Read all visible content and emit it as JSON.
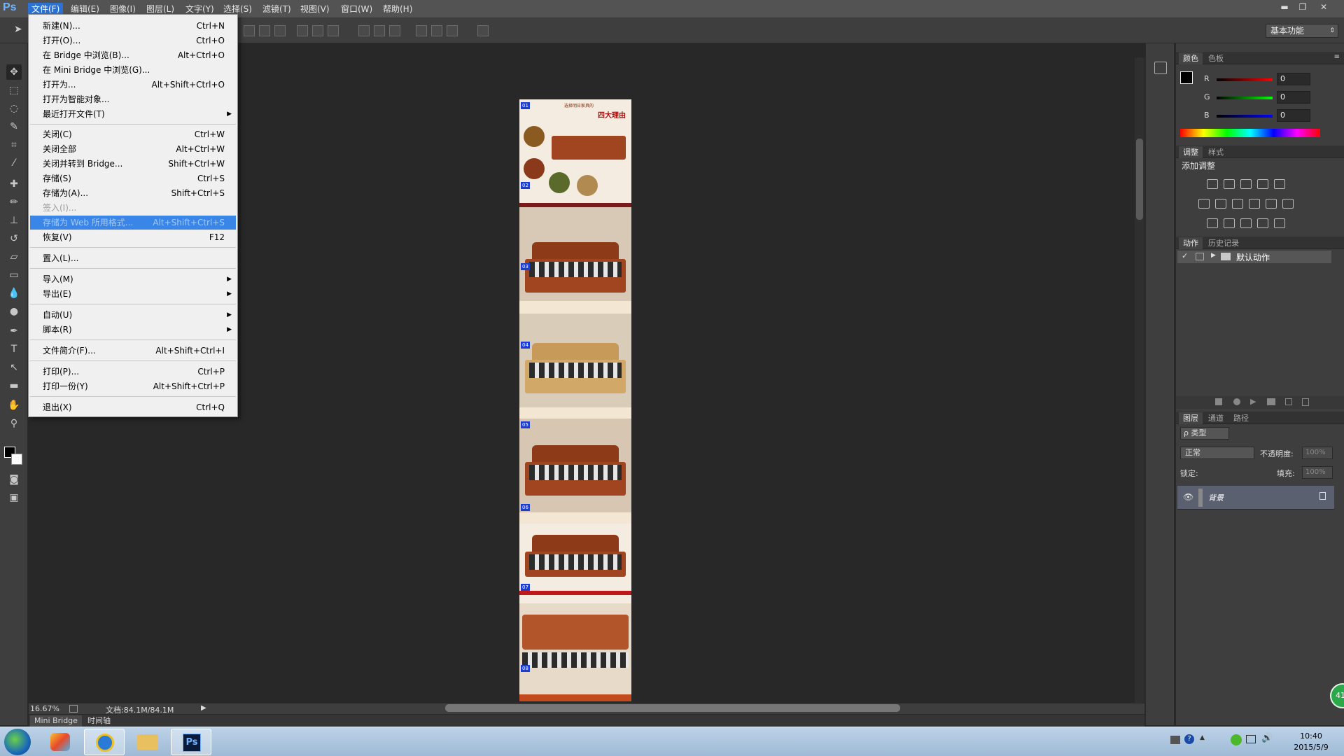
{
  "app": {
    "logo": "Ps"
  },
  "menubar": {
    "items": [
      "文件(F)",
      "编辑(E)",
      "图像(I)",
      "图层(L)",
      "文字(Y)",
      "选择(S)",
      "滤镜(T)",
      "视图(V)",
      "窗口(W)",
      "帮助(H)"
    ],
    "active": "文件(F)"
  },
  "window_controls": {
    "minimize": "▬",
    "restore": "❐",
    "close": "✕"
  },
  "workspace": {
    "label": "基本功能"
  },
  "file_menu": {
    "items": [
      {
        "label": "新建(N)...",
        "shortcut": "Ctrl+N"
      },
      {
        "label": "打开(O)...",
        "shortcut": "Ctrl+O"
      },
      {
        "label": "在 Bridge 中浏览(B)...",
        "shortcut": "Alt+Ctrl+O"
      },
      {
        "label": "在 Mini Bridge 中浏览(G)...",
        "shortcut": ""
      },
      {
        "label": "打开为...",
        "shortcut": "Alt+Shift+Ctrl+O"
      },
      {
        "label": "打开为智能对象...",
        "shortcut": ""
      },
      {
        "label": "最近打开文件(T)",
        "shortcut": ""
      },
      {
        "label": "关闭(C)",
        "shortcut": "Ctrl+W"
      },
      {
        "label": "关闭全部",
        "shortcut": "Alt+Ctrl+W"
      },
      {
        "label": "关闭并转到 Bridge...",
        "shortcut": "Shift+Ctrl+W"
      },
      {
        "label": "存储(S)",
        "shortcut": "Ctrl+S"
      },
      {
        "label": "存储为(A)...",
        "shortcut": "Shift+Ctrl+S"
      },
      {
        "label": "签入(I)...",
        "shortcut": ""
      },
      {
        "label": "存储为 Web 所用格式...",
        "shortcut": "Alt+Shift+Ctrl+S"
      },
      {
        "label": "恢复(V)",
        "shortcut": "F12"
      },
      {
        "label": "置入(L)...",
        "shortcut": ""
      },
      {
        "label": "导入(M)",
        "shortcut": ""
      },
      {
        "label": "导出(E)",
        "shortcut": ""
      },
      {
        "label": "自动(U)",
        "shortcut": ""
      },
      {
        "label": "脚本(R)",
        "shortcut": ""
      },
      {
        "label": "文件简介(F)...",
        "shortcut": "Alt+Shift+Ctrl+I"
      },
      {
        "label": "打印(P)...",
        "shortcut": "Ctrl+P"
      },
      {
        "label": "打印一份(Y)",
        "shortcut": "Alt+Shift+Ctrl+P"
      },
      {
        "label": "退出(X)",
        "shortcut": "Ctrl+Q"
      }
    ],
    "highlighted": "存储为 Web 所用格式...",
    "disabled": [
      "签入(I)..."
    ]
  },
  "document": {
    "slice_labels": [
      "01",
      "02",
      "03",
      "04",
      "05",
      "06",
      "07",
      "08"
    ],
    "title_text": "四大理由",
    "subtitle_text": "选择明日家具的"
  },
  "status": {
    "zoom": "16.67%",
    "doc_info": "文档:84.1M/84.1M"
  },
  "bottom_tabs": [
    "Mini Bridge",
    "时间轴"
  ],
  "color_panel": {
    "tabs": [
      "颜色",
      "色板"
    ],
    "channels": [
      {
        "name": "R",
        "value": "0"
      },
      {
        "name": "G",
        "value": "0"
      },
      {
        "name": "B",
        "value": "0"
      }
    ]
  },
  "adjustments_panel": {
    "tabs": [
      "调整",
      "样式"
    ],
    "heading": "添加调整"
  },
  "actions_panel": {
    "tabs": [
      "动作",
      "历史记录"
    ],
    "default_set": "默认动作"
  },
  "layers_panel": {
    "tabs": [
      "图层",
      "通道",
      "路径"
    ],
    "filter_kind": "ρ 类型",
    "blend_mode": "正常",
    "opacity_label": "不透明度:",
    "opacity_value": "100%",
    "lock_label": "锁定:",
    "fill_label": "填充:",
    "fill_value": "100%",
    "layers": [
      {
        "name": "背景",
        "visible": true,
        "locked": true
      }
    ]
  },
  "taskbar": {
    "time": "10:40",
    "date": "2015/5/9",
    "badge": "41"
  },
  "colors": {
    "ps_blue": "#6fb3ff",
    "menu_highlight": "#3a86e8",
    "slice_blue": "#1b3dd4"
  }
}
